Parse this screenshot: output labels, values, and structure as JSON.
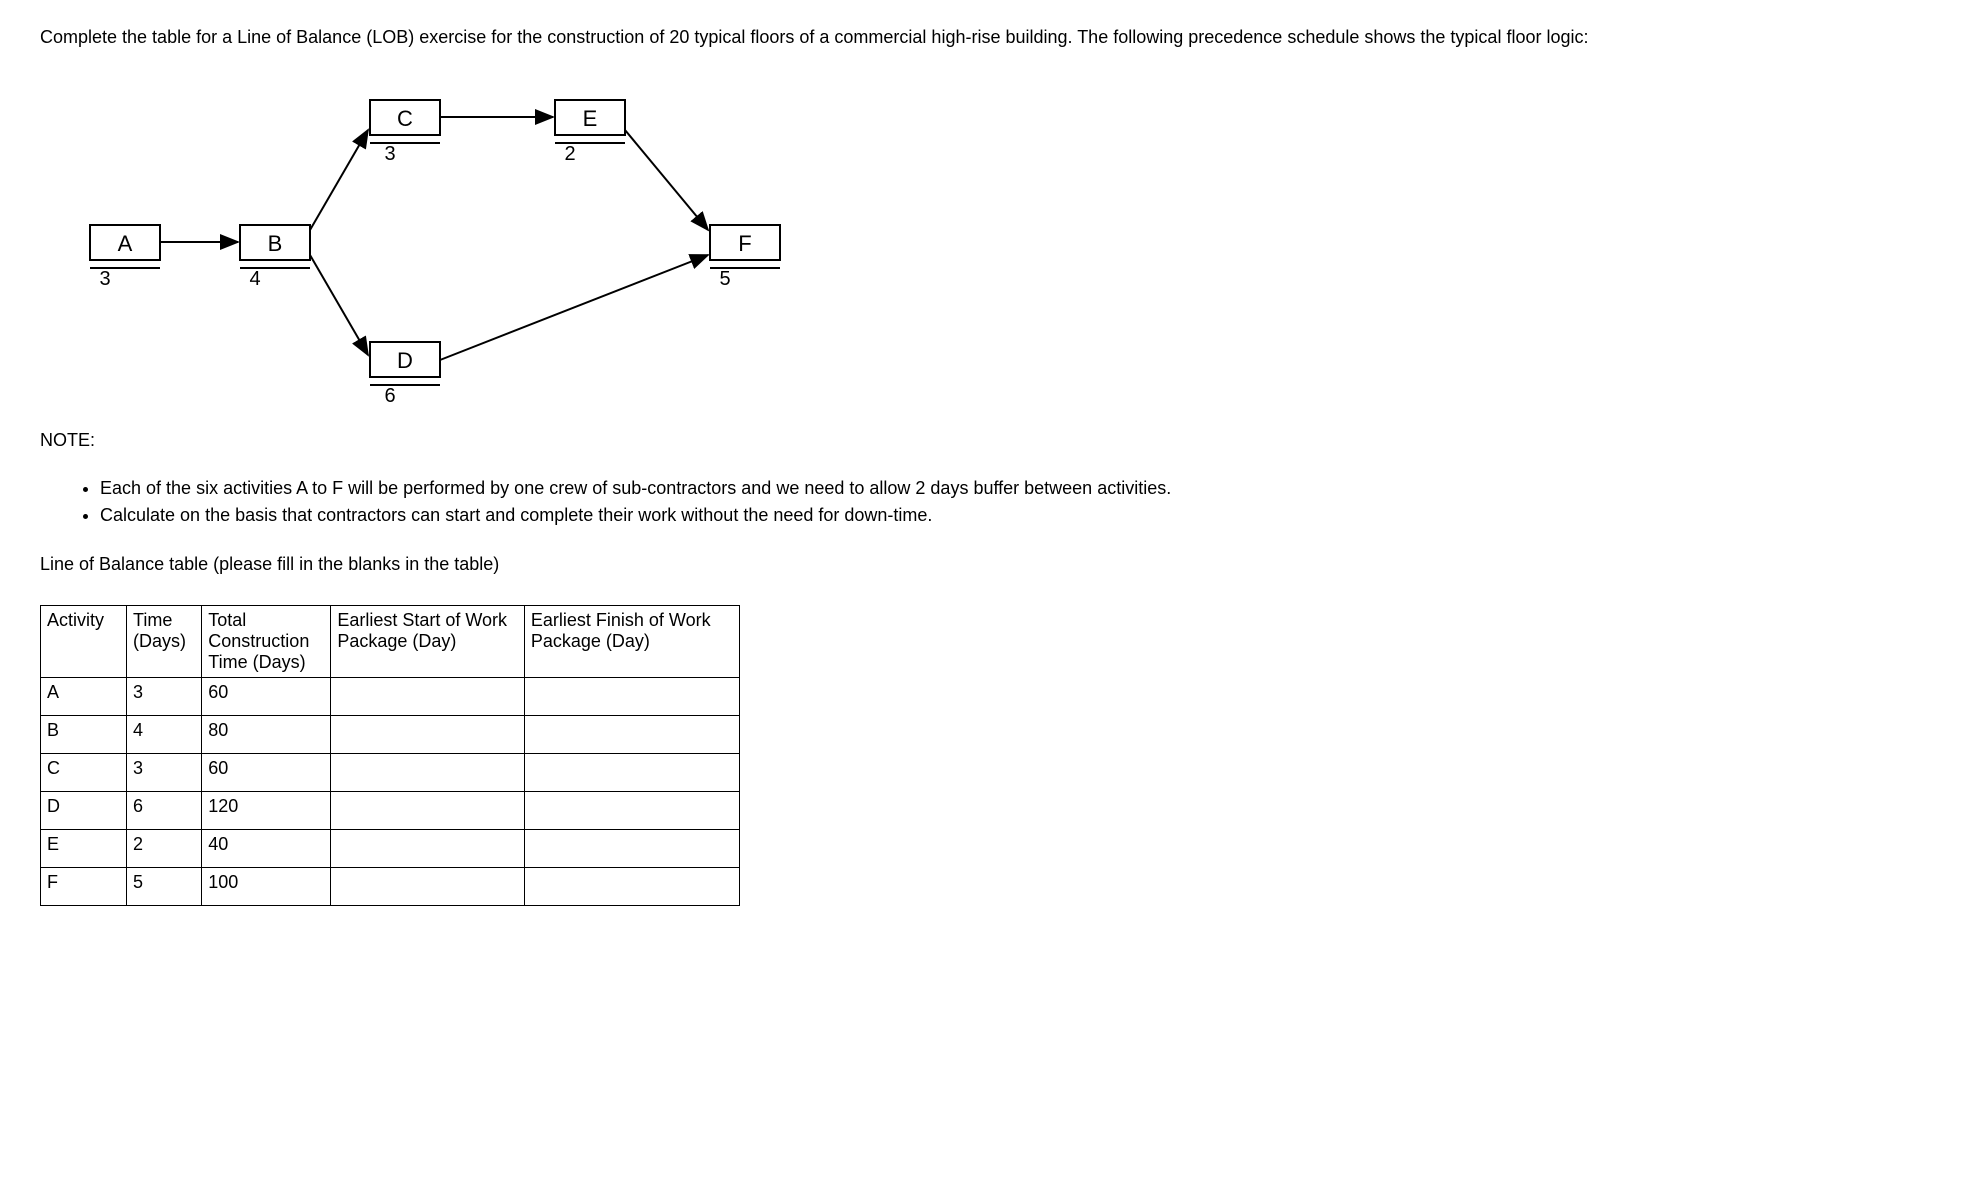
{
  "intro": "Complete the table for a Line of Balance (LOB) exercise for the construction of 20 typical floors of a commercial high-rise building. The following precedence schedule shows the typical floor logic:",
  "diagram": {
    "nodes": {
      "A": {
        "label": "A",
        "duration": "3"
      },
      "B": {
        "label": "B",
        "duration": "4"
      },
      "C": {
        "label": "C",
        "duration": "3"
      },
      "D": {
        "label": "D",
        "duration": "6"
      },
      "E": {
        "label": "E",
        "duration": "2"
      },
      "F": {
        "label": "F",
        "duration": "5"
      }
    }
  },
  "noteLabel": "NOTE:",
  "notes": [
    "Each of the six activities A to F will be performed by one crew of sub-contractors and we need to allow 2 days buffer between activities.",
    "Calculate on the basis that contractors can start and complete their work without the need for down-time."
  ],
  "tableIntro": "Line of Balance table (please fill in the blanks in the table)",
  "table": {
    "headers": {
      "activity": "Activity",
      "time": "Time (Days)",
      "total": "Total Construction Time (Days)",
      "start": "Earliest Start of Work Package (Day)",
      "finish": "Earliest Finish of Work Package (Day)"
    },
    "rows": [
      {
        "activity": "A",
        "time": "3",
        "total": "60",
        "start": "",
        "finish": ""
      },
      {
        "activity": "B",
        "time": "4",
        "total": "80",
        "start": "",
        "finish": ""
      },
      {
        "activity": "C",
        "time": "3",
        "total": "60",
        "start": "",
        "finish": ""
      },
      {
        "activity": "D",
        "time": "6",
        "total": "120",
        "start": "",
        "finish": ""
      },
      {
        "activity": "E",
        "time": "2",
        "total": "40",
        "start": "",
        "finish": ""
      },
      {
        "activity": "F",
        "time": "5",
        "total": "100",
        "start": "",
        "finish": ""
      }
    ]
  }
}
